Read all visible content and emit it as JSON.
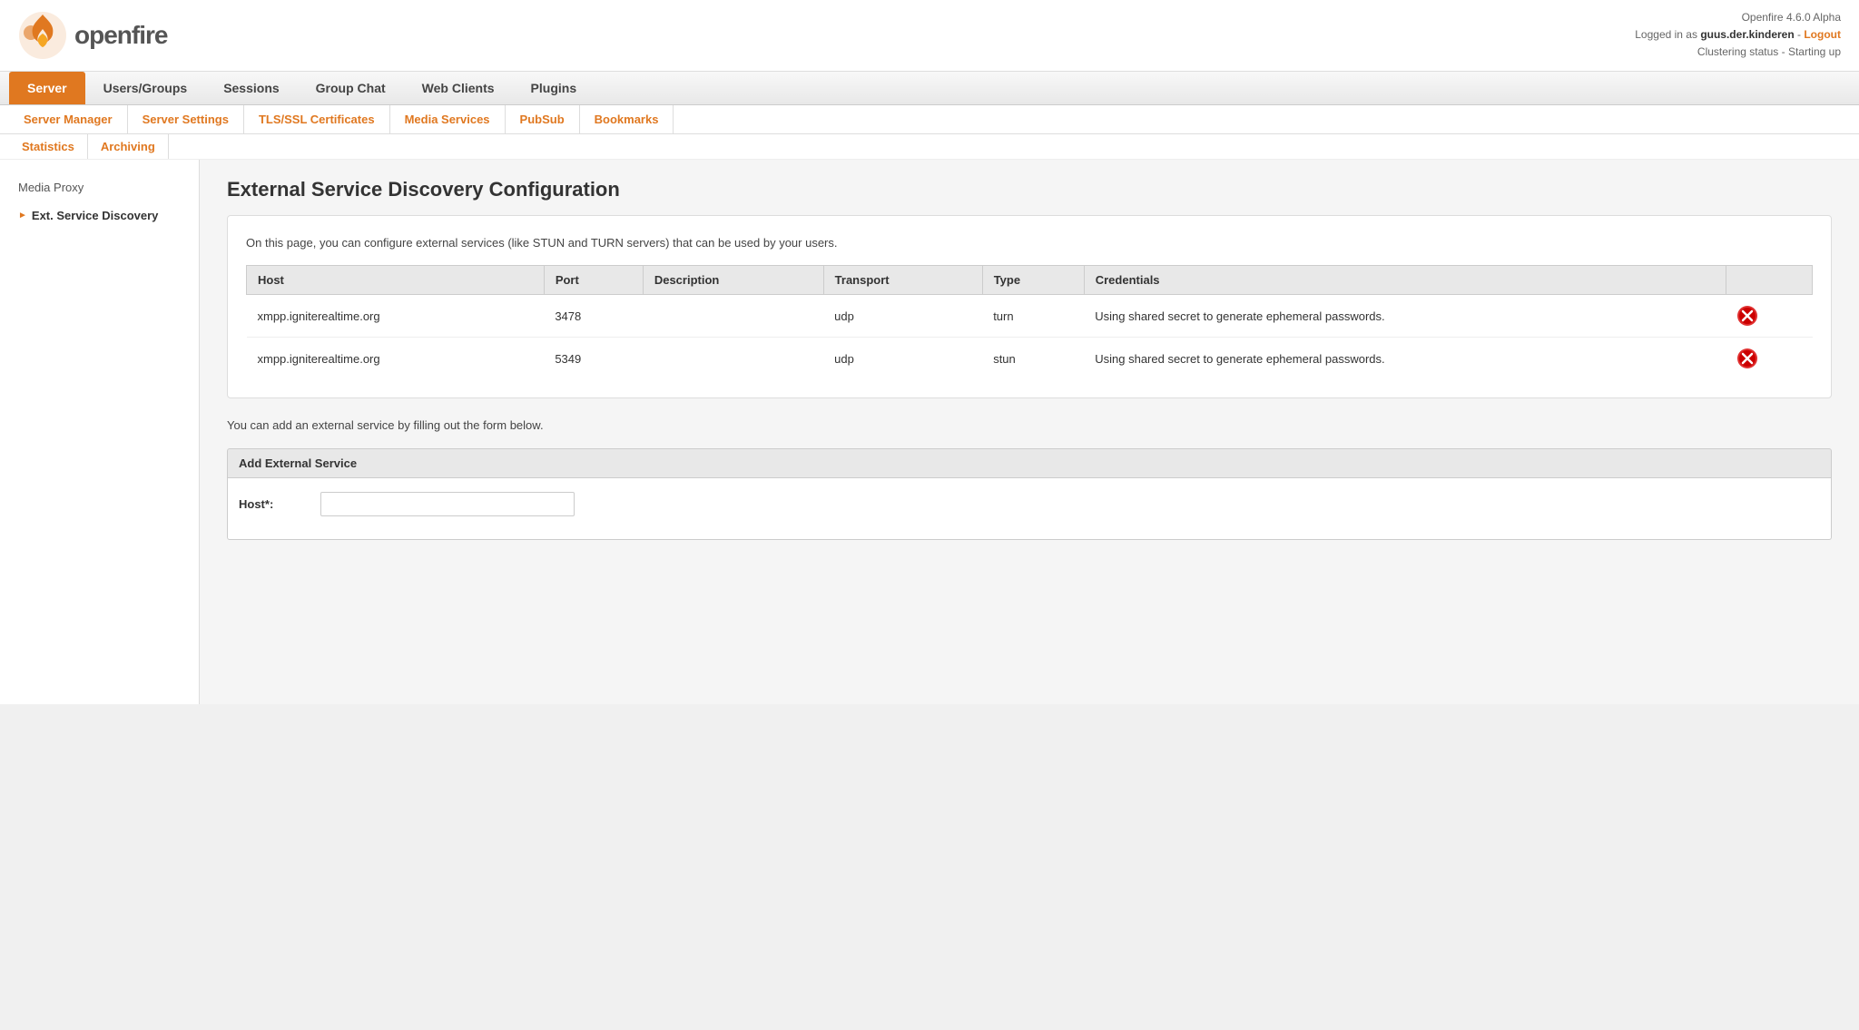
{
  "header": {
    "app_name": "openfire",
    "version_info": "Openfire 4.6.0 Alpha",
    "logged_in_text": "Logged in as ",
    "username": "guus.der.kinderen",
    "separator": " - ",
    "logout_label": "Logout",
    "clustering_status": "Clustering status - Starting up"
  },
  "main_nav": {
    "items": [
      {
        "id": "server",
        "label": "Server",
        "active": true
      },
      {
        "id": "users-groups",
        "label": "Users/Groups",
        "active": false
      },
      {
        "id": "sessions",
        "label": "Sessions",
        "active": false
      },
      {
        "id": "group-chat",
        "label": "Group Chat",
        "active": false
      },
      {
        "id": "web-clients",
        "label": "Web Clients",
        "active": false
      },
      {
        "id": "plugins",
        "label": "Plugins",
        "active": false
      }
    ]
  },
  "sub_nav": {
    "items": [
      {
        "id": "server-manager",
        "label": "Server Manager"
      },
      {
        "id": "server-settings",
        "label": "Server Settings"
      },
      {
        "id": "tls-ssl",
        "label": "TLS/SSL Certificates"
      },
      {
        "id": "media-services",
        "label": "Media Services",
        "active": true
      },
      {
        "id": "pubsub",
        "label": "PubSub"
      },
      {
        "id": "bookmarks",
        "label": "Bookmarks"
      }
    ]
  },
  "second_sub_nav": {
    "items": [
      {
        "id": "statistics",
        "label": "Statistics"
      },
      {
        "id": "archiving",
        "label": "Archiving"
      }
    ]
  },
  "sidebar": {
    "items": [
      {
        "id": "media-proxy",
        "label": "Media Proxy",
        "active": false,
        "arrow": false
      },
      {
        "id": "ext-service-discovery",
        "label": "Ext. Service Discovery",
        "active": true,
        "arrow": true
      }
    ]
  },
  "main": {
    "page_title": "External Service Discovery Configuration",
    "intro_text": "On this page, you can configure external services (like STUN and TURN servers) that can be used by your users.",
    "table": {
      "columns": [
        "Host",
        "Port",
        "Description",
        "Transport",
        "Type",
        "Credentials"
      ],
      "rows": [
        {
          "host": "xmpp.igniterealtime.org",
          "port": "3478",
          "description": "",
          "transport": "udp",
          "type": "turn",
          "credentials": "Using shared secret to generate ephemeral passwords."
        },
        {
          "host": "xmpp.igniterealtime.org",
          "port": "5349",
          "description": "",
          "transport": "udp",
          "type": "stun",
          "credentials": "Using shared secret to generate ephemeral passwords."
        }
      ]
    },
    "add_service_text": "You can add an external service by filling out the form below.",
    "add_section_title": "Add External Service",
    "form": {
      "host_label": "Host*:",
      "host_placeholder": ""
    }
  }
}
